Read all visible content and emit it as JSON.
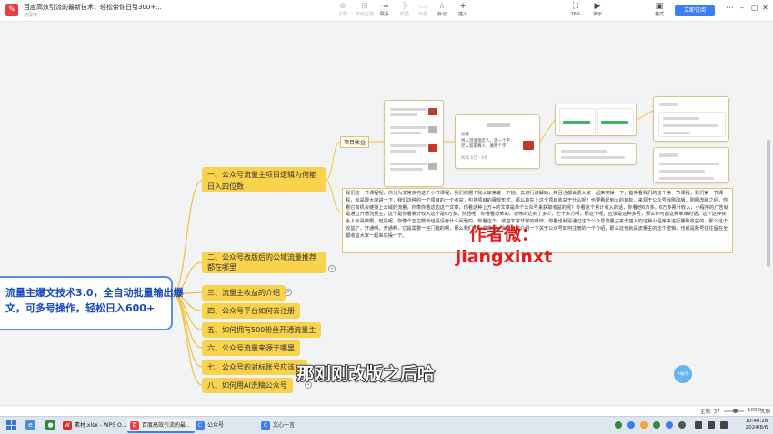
{
  "toolbar": {
    "doc_title": "百度高效引流的最新技术，轻松带你日引300+...",
    "doc_status": "已保存",
    "buttons": [
      {
        "icon": "insert-child-icon",
        "glyph": "⊕",
        "label": "子题",
        "enabled": false
      },
      {
        "icon": "insert-sibling-icon",
        "glyph": "⊞",
        "label": "平级主题",
        "enabled": false
      },
      {
        "icon": "association-icon",
        "glyph": "↝",
        "label": "联系",
        "enabled": true
      },
      {
        "icon": "summary-icon",
        "glyph": "}",
        "label": "概要",
        "enabled": false
      },
      {
        "icon": "boundary-icon",
        "glyph": "▭",
        "label": "外框",
        "enabled": false
      },
      {
        "icon": "mark-icon",
        "glyph": "☆",
        "label": "标记",
        "enabled": true
      },
      {
        "icon": "insert-icon",
        "glyph": "+",
        "label": "插入",
        "enabled": true
      },
      {
        "icon": "zoom-fit-icon",
        "glyph": "⛶",
        "label": "26%",
        "enabled": true
      },
      {
        "icon": "present-icon",
        "glyph": "▶",
        "label": "演示",
        "enabled": true
      },
      {
        "icon": "style-icon",
        "glyph": "▣",
        "label": "格式",
        "enabled": true
      }
    ],
    "subscribe_label": "立即订阅"
  },
  "mindmap": {
    "root_lines": [
      "流量主爆文技术3.0，全自动批量输出爆",
      "文，可多号操作，轻松日入600+"
    ],
    "topics": [
      {
        "text": "一、公众号流量主项目逻辑为何能日入四位数",
        "size": "big"
      },
      {
        "text": "二、公众号改版后的公域流量推荐都在哪里",
        "size": "two"
      },
      {
        "text": "三、流量主收益的介绍"
      },
      {
        "text": "四、公众号平台如何去注册"
      },
      {
        "text": "五、如何拥有500粉丝开通流量主"
      },
      {
        "text": "六、公众号流量来源于哪里"
      },
      {
        "text": "七、公众号的对标账号应该..."
      },
      {
        "text": "八、如何用AI洗稿公众号"
      }
    ],
    "subtopic_label": "项目收益",
    "thumb_texts": {
      "t2_header": "标题",
      "t2_title": "男人湿漉漉走人，第一个字：老人留家赛人，难两个字",
      "t2_meta": "阅读 8万 · 4条"
    },
    "paragraph": "我们这一节课程呢，你分为非常多的这个小节课程，我们依据个我大家来说一下她，去进行讲解她，并且也都会很大家一起来实操一下，首先看我们的这个第一节课程，我们第一节课程，就是跟大家讲一下，我们这种的一个项目的一个收益，包括项目的展现形式，那么首先上这个项目收益干什么呢？也要看起到大的目标，来源于公众号我刚改版，刚刚改版之后，你看它有机会链接上公域的流量，你像你看这边这个文章，你看这种上万+的文章是单个公众号来获取收益的呢？你看这个累计收入的话，你看他6万多，6万多累计收入，小程序的广告就是通过开通流量主，这个是你看累计收入这个是6万多，然后呢，你看看恐怖的，恐怖的达到了多少，七十多万啊，那这个呢，应该是这种多号，那么你可能这种单单的话，这个这种快手人就是做跟，但是呢，你像个五位数就也是没有什么问题的，你看这个，收益非常非常的爆炸，你看也就是通过这个公众号流量主来去插入的这种小程序来进行捕取收益的，那么这个收益了，开通啊，开通啊，它是需要一些门槛的啊，那么我们下一节课程，会跟大家介绍一下关于公众号如何注册的一个介绍，那么这也就是流量主的这个逻辑，也就是账号往往留在全都收益大家一起来实操一下。",
    "author_lines": [
      "作者微：",
      "jiangxinxt"
    ],
    "subtitle": "那刚刚改版之后哈",
    "float_button": "AI助手"
  },
  "statusbar": {
    "topic_count": "主题: 37",
    "zoom": "100%",
    "size_label": "大纲"
  },
  "taskbar": {
    "apps": [
      {
        "label": "素材.xlsx - WPS O...",
        "color": "#d93025",
        "glyph": "W"
      },
      {
        "label": "百度高效引流的最...",
        "color": "#e84040",
        "glyph": "百",
        "active": true
      },
      {
        "label": "公众号",
        "color": "#3d7ef5",
        "glyph": "C"
      },
      {
        "label": "文心一言",
        "color": "#3d7ef5",
        "glyph": "C"
      }
    ],
    "time": "10:40:28",
    "date": "2024/8/6"
  },
  "colors": {
    "topic_fill": "#fad34c",
    "root_border": "#5b8def",
    "root_text": "#1a48c0",
    "author_red": "#e01e1e",
    "accent_blue": "#3d7ef5"
  }
}
